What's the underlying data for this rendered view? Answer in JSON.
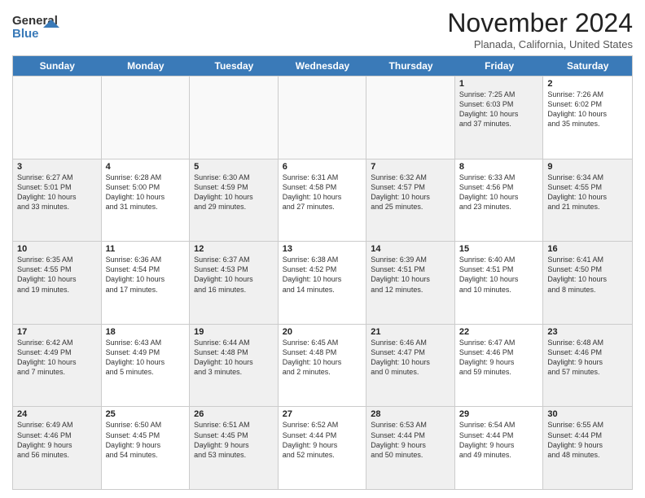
{
  "header": {
    "logo_general": "General",
    "logo_blue": "Blue",
    "month_title": "November 2024",
    "location": "Planada, California, United States"
  },
  "days_of_week": [
    "Sunday",
    "Monday",
    "Tuesday",
    "Wednesday",
    "Thursday",
    "Friday",
    "Saturday"
  ],
  "weeks": [
    [
      {
        "day": "",
        "info": "",
        "empty": true
      },
      {
        "day": "",
        "info": "",
        "empty": true
      },
      {
        "day": "",
        "info": "",
        "empty": true
      },
      {
        "day": "",
        "info": "",
        "empty": true
      },
      {
        "day": "",
        "info": "",
        "empty": true
      },
      {
        "day": "1",
        "info": "Sunrise: 7:25 AM\nSunset: 6:03 PM\nDaylight: 10 hours\nand 37 minutes.",
        "empty": false,
        "shaded": true
      },
      {
        "day": "2",
        "info": "Sunrise: 7:26 AM\nSunset: 6:02 PM\nDaylight: 10 hours\nand 35 minutes.",
        "empty": false,
        "shaded": false
      }
    ],
    [
      {
        "day": "3",
        "info": "Sunrise: 6:27 AM\nSunset: 5:01 PM\nDaylight: 10 hours\nand 33 minutes.",
        "empty": false,
        "shaded": true
      },
      {
        "day": "4",
        "info": "Sunrise: 6:28 AM\nSunset: 5:00 PM\nDaylight: 10 hours\nand 31 minutes.",
        "empty": false,
        "shaded": false
      },
      {
        "day": "5",
        "info": "Sunrise: 6:30 AM\nSunset: 4:59 PM\nDaylight: 10 hours\nand 29 minutes.",
        "empty": false,
        "shaded": true
      },
      {
        "day": "6",
        "info": "Sunrise: 6:31 AM\nSunset: 4:58 PM\nDaylight: 10 hours\nand 27 minutes.",
        "empty": false,
        "shaded": false
      },
      {
        "day": "7",
        "info": "Sunrise: 6:32 AM\nSunset: 4:57 PM\nDaylight: 10 hours\nand 25 minutes.",
        "empty": false,
        "shaded": true
      },
      {
        "day": "8",
        "info": "Sunrise: 6:33 AM\nSunset: 4:56 PM\nDaylight: 10 hours\nand 23 minutes.",
        "empty": false,
        "shaded": false
      },
      {
        "day": "9",
        "info": "Sunrise: 6:34 AM\nSunset: 4:55 PM\nDaylight: 10 hours\nand 21 minutes.",
        "empty": false,
        "shaded": true
      }
    ],
    [
      {
        "day": "10",
        "info": "Sunrise: 6:35 AM\nSunset: 4:55 PM\nDaylight: 10 hours\nand 19 minutes.",
        "empty": false,
        "shaded": true
      },
      {
        "day": "11",
        "info": "Sunrise: 6:36 AM\nSunset: 4:54 PM\nDaylight: 10 hours\nand 17 minutes.",
        "empty": false,
        "shaded": false
      },
      {
        "day": "12",
        "info": "Sunrise: 6:37 AM\nSunset: 4:53 PM\nDaylight: 10 hours\nand 16 minutes.",
        "empty": false,
        "shaded": true
      },
      {
        "day": "13",
        "info": "Sunrise: 6:38 AM\nSunset: 4:52 PM\nDaylight: 10 hours\nand 14 minutes.",
        "empty": false,
        "shaded": false
      },
      {
        "day": "14",
        "info": "Sunrise: 6:39 AM\nSunset: 4:51 PM\nDaylight: 10 hours\nand 12 minutes.",
        "empty": false,
        "shaded": true
      },
      {
        "day": "15",
        "info": "Sunrise: 6:40 AM\nSunset: 4:51 PM\nDaylight: 10 hours\nand 10 minutes.",
        "empty": false,
        "shaded": false
      },
      {
        "day": "16",
        "info": "Sunrise: 6:41 AM\nSunset: 4:50 PM\nDaylight: 10 hours\nand 8 minutes.",
        "empty": false,
        "shaded": true
      }
    ],
    [
      {
        "day": "17",
        "info": "Sunrise: 6:42 AM\nSunset: 4:49 PM\nDaylight: 10 hours\nand 7 minutes.",
        "empty": false,
        "shaded": true
      },
      {
        "day": "18",
        "info": "Sunrise: 6:43 AM\nSunset: 4:49 PM\nDaylight: 10 hours\nand 5 minutes.",
        "empty": false,
        "shaded": false
      },
      {
        "day": "19",
        "info": "Sunrise: 6:44 AM\nSunset: 4:48 PM\nDaylight: 10 hours\nand 3 minutes.",
        "empty": false,
        "shaded": true
      },
      {
        "day": "20",
        "info": "Sunrise: 6:45 AM\nSunset: 4:48 PM\nDaylight: 10 hours\nand 2 minutes.",
        "empty": false,
        "shaded": false
      },
      {
        "day": "21",
        "info": "Sunrise: 6:46 AM\nSunset: 4:47 PM\nDaylight: 10 hours\nand 0 minutes.",
        "empty": false,
        "shaded": true
      },
      {
        "day": "22",
        "info": "Sunrise: 6:47 AM\nSunset: 4:46 PM\nDaylight: 9 hours\nand 59 minutes.",
        "empty": false,
        "shaded": false
      },
      {
        "day": "23",
        "info": "Sunrise: 6:48 AM\nSunset: 4:46 PM\nDaylight: 9 hours\nand 57 minutes.",
        "empty": false,
        "shaded": true
      }
    ],
    [
      {
        "day": "24",
        "info": "Sunrise: 6:49 AM\nSunset: 4:46 PM\nDaylight: 9 hours\nand 56 minutes.",
        "empty": false,
        "shaded": true
      },
      {
        "day": "25",
        "info": "Sunrise: 6:50 AM\nSunset: 4:45 PM\nDaylight: 9 hours\nand 54 minutes.",
        "empty": false,
        "shaded": false
      },
      {
        "day": "26",
        "info": "Sunrise: 6:51 AM\nSunset: 4:45 PM\nDaylight: 9 hours\nand 53 minutes.",
        "empty": false,
        "shaded": true
      },
      {
        "day": "27",
        "info": "Sunrise: 6:52 AM\nSunset: 4:44 PM\nDaylight: 9 hours\nand 52 minutes.",
        "empty": false,
        "shaded": false
      },
      {
        "day": "28",
        "info": "Sunrise: 6:53 AM\nSunset: 4:44 PM\nDaylight: 9 hours\nand 50 minutes.",
        "empty": false,
        "shaded": true
      },
      {
        "day": "29",
        "info": "Sunrise: 6:54 AM\nSunset: 4:44 PM\nDaylight: 9 hours\nand 49 minutes.",
        "empty": false,
        "shaded": false
      },
      {
        "day": "30",
        "info": "Sunrise: 6:55 AM\nSunset: 4:44 PM\nDaylight: 9 hours\nand 48 minutes.",
        "empty": false,
        "shaded": true
      }
    ]
  ]
}
